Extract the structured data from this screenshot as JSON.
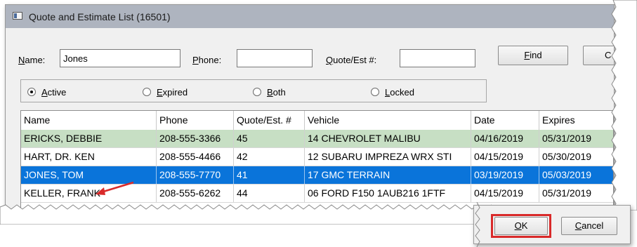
{
  "window": {
    "title": "Quote and Estimate List (16501)"
  },
  "search": {
    "name_label": "Name:",
    "name_accel": "N",
    "name_rest": "ame:",
    "name_value": "Jones",
    "phone_accel": "P",
    "phone_rest": "hone:",
    "phone_value": "",
    "quote_accel": "Q",
    "quote_rest": "uote/Est #:",
    "quote_value": "",
    "find_accel": "F",
    "find_rest": "ind",
    "partial_button": "C"
  },
  "filters": [
    {
      "accel": "A",
      "rest": "ctive",
      "selected": true
    },
    {
      "accel": "E",
      "rest": "xpired",
      "selected": false
    },
    {
      "accel": "B",
      "rest": "oth",
      "selected": false
    },
    {
      "accel": "L",
      "rest": "ocked",
      "selected": false
    }
  ],
  "table": {
    "columns": [
      "Name",
      "Phone",
      "Quote/Est. #",
      "Vehicle",
      "Date",
      "Expires"
    ],
    "rows": [
      {
        "name": "ERICKS, DEBBIE",
        "phone": "208-555-3366",
        "quote": "45",
        "vehicle": "14 CHEVROLET MALIBU",
        "date": "04/16/2019",
        "expires": "05/31/2019",
        "state": "green"
      },
      {
        "name": "HART, DR. KEN",
        "phone": "208-555-4466",
        "quote": "42",
        "vehicle": "12 SUBARU IMPREZA WRX STI",
        "date": "04/15/2019",
        "expires": "05/30/2019",
        "state": "white"
      },
      {
        "name": "JONES, TOM",
        "phone": "208-555-7770",
        "quote": "41",
        "vehicle": "17 GMC TERRAIN",
        "date": "03/19/2019",
        "expires": "05/03/2019",
        "state": "selected"
      },
      {
        "name": "KELLER, FRANK",
        "phone": "208-555-6262",
        "quote": "44",
        "vehicle": "06 FORD F150 1AUB216 1FTF",
        "date": "04/15/2019",
        "expires": "05/31/2019",
        "state": "white"
      }
    ]
  },
  "footer": {
    "ok_accel": "O",
    "ok_rest": "K",
    "cancel_accel": "C",
    "cancel_rest": "ancel"
  },
  "colors": {
    "selected_row": "#0a74da",
    "green_row": "#c7dfc4",
    "highlight_box": "#d92a2a",
    "arrow": "#d92a2a"
  }
}
